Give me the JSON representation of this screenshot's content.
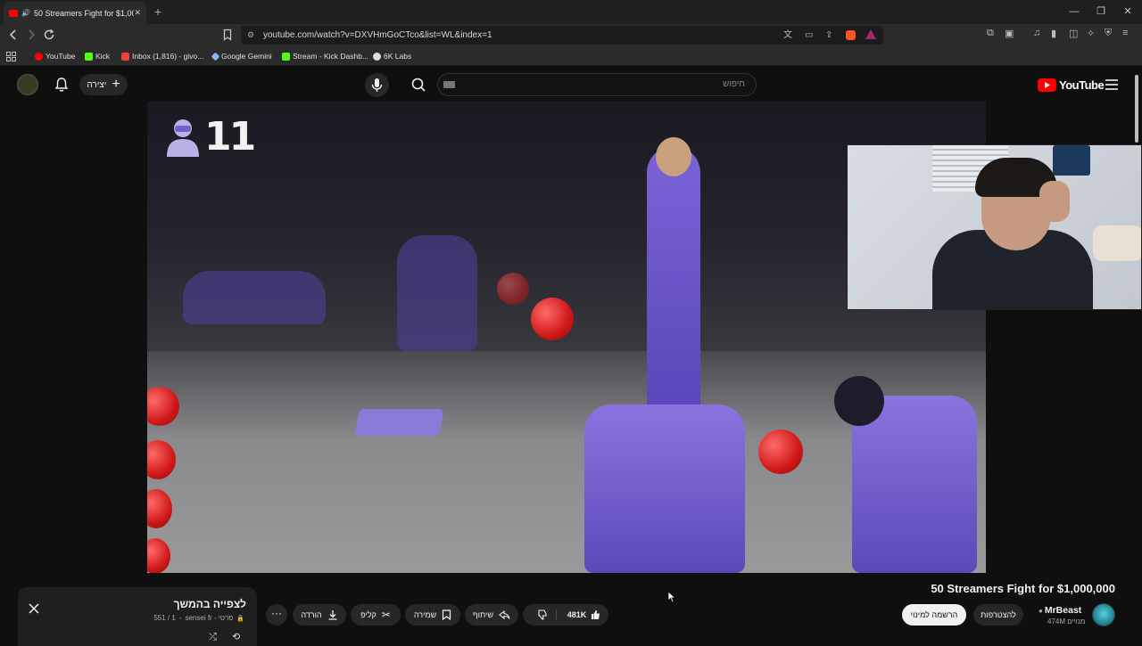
{
  "browser": {
    "tab_title": "50 Streamers Fight for $1,000...",
    "new_tab": "+",
    "window_controls": {
      "minimize": "—",
      "maximize": "❐",
      "close": "✕"
    },
    "url": "youtube.com/watch?v=DXVHmGoCTco&list=WL&index=1",
    "bookmarks": [
      {
        "label": "YouTube",
        "color": "#ff0000"
      },
      {
        "label": "Kick",
        "color": "#53fc18"
      },
      {
        "label": "Inbox (1,816) - givo...",
        "color": "#ea4335"
      },
      {
        "label": "Google Gemini",
        "color": "#8ab4f8"
      },
      {
        "label": "Stream - Kick Dashb...",
        "color": "#53fc18"
      },
      {
        "label": "6K Labs",
        "color": "#dddddd"
      }
    ]
  },
  "youtube": {
    "logo_text": "YouTube",
    "search_placeholder": "חיפוש",
    "create_label": "יצירה",
    "accent": "#ff0000"
  },
  "player": {
    "overlay_count": "11"
  },
  "video": {
    "title": "50 Streamers Fight for $1,000,000",
    "channel": {
      "name": "MrBeast",
      "subscribers": "474M מנויים",
      "verified_icon": "check-circle-icon"
    },
    "subscribe_label": "הרשמה למינוי",
    "join_label": "להצטרפות",
    "likes": "481K",
    "share_label": "שיתוף",
    "save_label": "שמירה",
    "clip_label": "קליפ",
    "download_label": "הורדה"
  },
  "playlist": {
    "title": "לצפייה בהמשך",
    "subtitle": "sensei fr - פרטי",
    "position": "551 / 1"
  }
}
